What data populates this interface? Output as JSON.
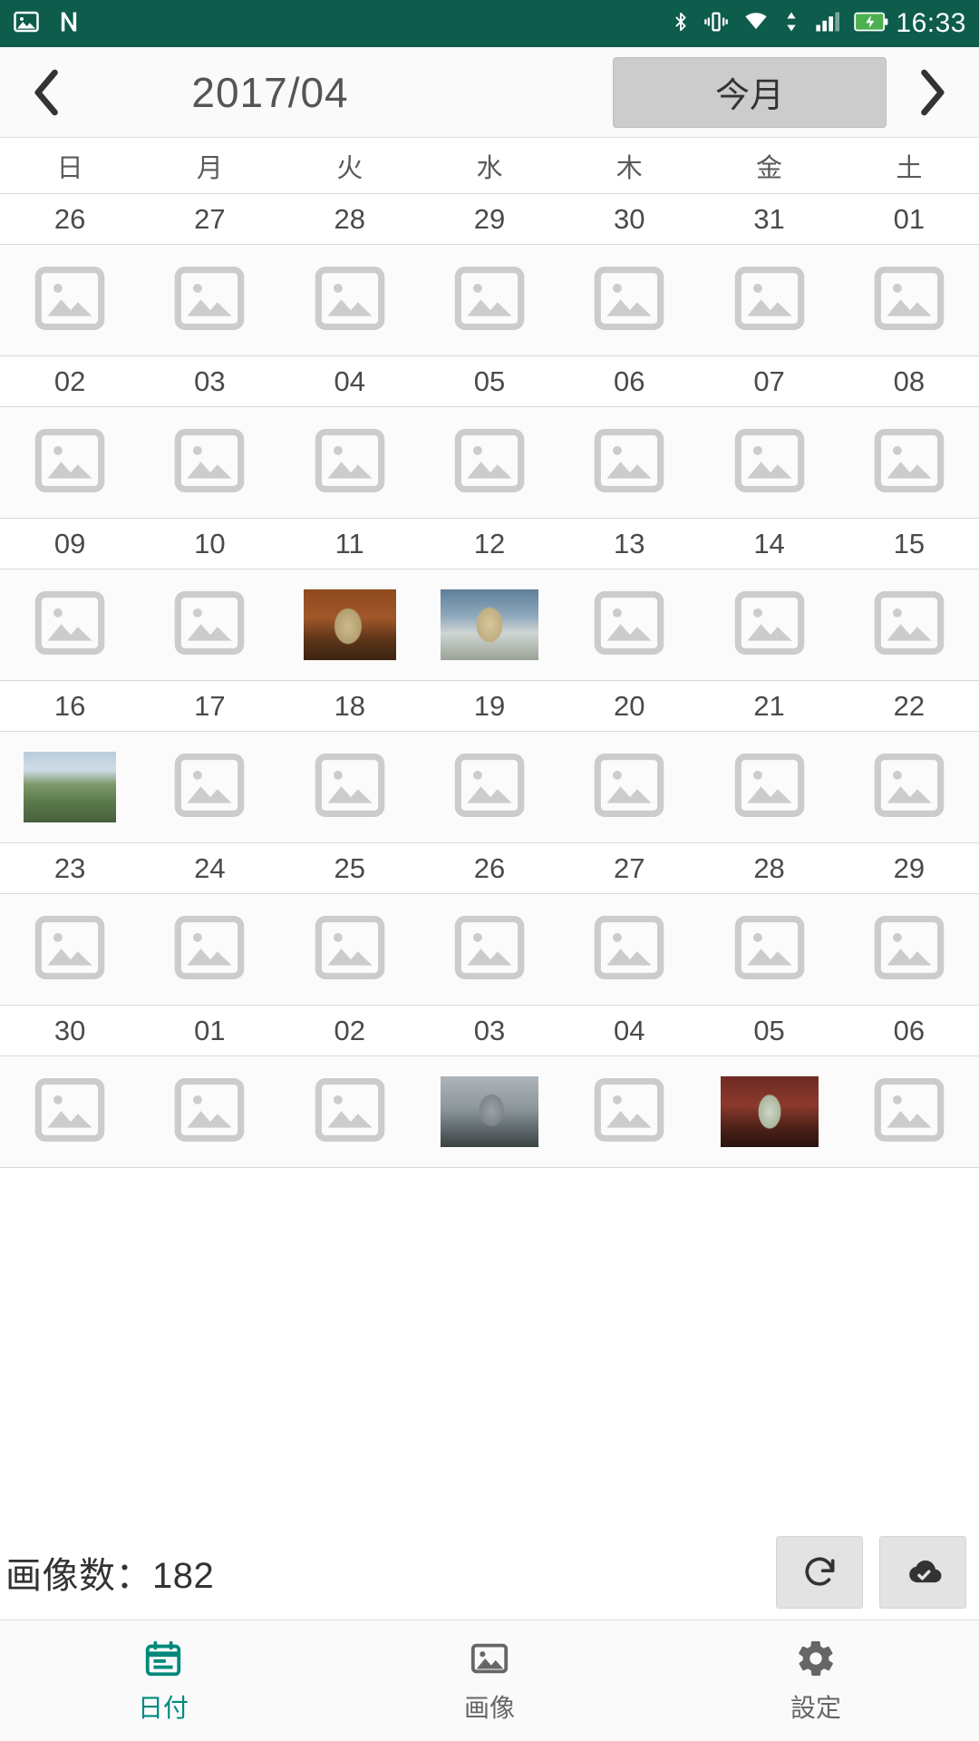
{
  "statusbar": {
    "time": "16:33",
    "icons_left": [
      "gallery-icon",
      "nfc-icon"
    ],
    "icons_right": [
      "bluetooth-icon",
      "vibrate-icon",
      "wifi-icon",
      "data-transfer-icon",
      "signal-icon",
      "battery-charging-icon"
    ],
    "background": "#0d5c4c"
  },
  "header": {
    "prev_label": "❮",
    "month": "2017/04",
    "today_label": "今月",
    "next_label": "❯"
  },
  "calendar": {
    "weekdays": [
      "日",
      "月",
      "火",
      "水",
      "木",
      "金",
      "土"
    ],
    "weeks": [
      {
        "days": [
          "26",
          "27",
          "28",
          "29",
          "30",
          "31",
          "01"
        ],
        "thumbs": [
          null,
          null,
          null,
          null,
          null,
          null,
          null
        ]
      },
      {
        "days": [
          "02",
          "03",
          "04",
          "05",
          "06",
          "07",
          "08"
        ],
        "thumbs": [
          null,
          null,
          null,
          null,
          null,
          null,
          null
        ]
      },
      {
        "days": [
          "09",
          "10",
          "11",
          "12",
          "13",
          "14",
          "15"
        ],
        "thumbs": [
          null,
          null,
          "th-figure-orange",
          "th-figure-blue",
          null,
          null,
          null
        ]
      },
      {
        "days": [
          "16",
          "17",
          "18",
          "19",
          "20",
          "21",
          "22"
        ],
        "thumbs": [
          "th-landscape",
          null,
          null,
          null,
          null,
          null,
          null
        ]
      },
      {
        "days": [
          "23",
          "24",
          "25",
          "26",
          "27",
          "28",
          "29"
        ],
        "thumbs": [
          null,
          null,
          null,
          null,
          null,
          null,
          null
        ]
      },
      {
        "days": [
          "30",
          "01",
          "02",
          "03",
          "04",
          "05",
          "06"
        ],
        "thumbs": [
          null,
          null,
          null,
          "th-figure-car",
          null,
          "th-figure-red",
          null
        ]
      }
    ]
  },
  "footer": {
    "count_text": "画像数：182",
    "refresh_icon": "refresh-icon",
    "cloud_icon": "cloud-done-icon"
  },
  "tabs": [
    {
      "label": "日付",
      "icon": "calendar-icon",
      "active": true
    },
    {
      "label": "画像",
      "icon": "image-icon",
      "active": false
    },
    {
      "label": "設定",
      "icon": "gear-icon",
      "active": false
    }
  ],
  "colors": {
    "status_bar": "#0d5c4c",
    "accent": "#00897b",
    "placeholder": "#cccccc"
  }
}
